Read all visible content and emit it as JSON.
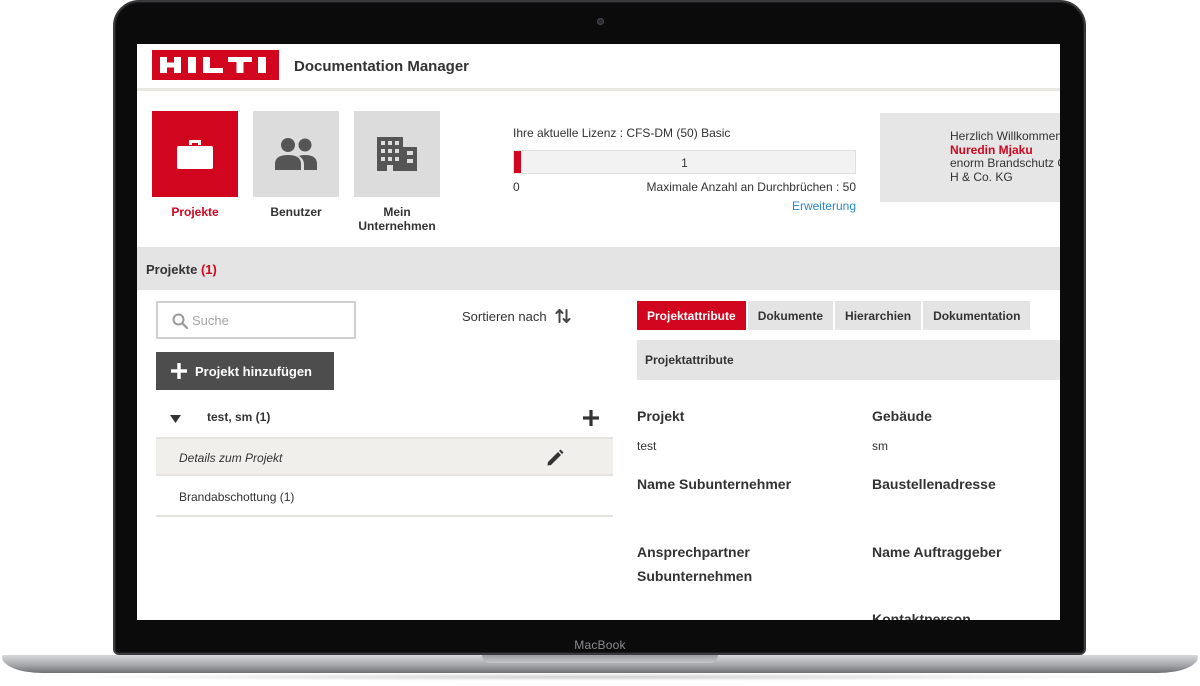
{
  "app": {
    "logo_text": "HILTI",
    "title": "Documentation Manager"
  },
  "nav": {
    "tiles": [
      {
        "label": "Projekte",
        "icon": "briefcase-icon",
        "active": true
      },
      {
        "label": "Benutzer",
        "icon": "users-icon",
        "active": false
      },
      {
        "label": "Mein\nUnternehmen",
        "icon": "building-icon",
        "active": false
      }
    ]
  },
  "license": {
    "text": "Ihre aktuelle Lizenz : CFS-DM (50) Basic",
    "current": "1",
    "used_fraction": 0.02,
    "min": "0",
    "max_text": "Maximale Anzahl an Durchbrüchen : 50",
    "upgrade_link": "Erweiterung"
  },
  "welcome": {
    "greeting": "Herzlich Willkommen",
    "name": "Nuredin Mjaku",
    "company_line1": "enorm Brandschutz G",
    "company_line2": "H & Co. KG"
  },
  "projects_section": {
    "title": "Projekte",
    "count": "(1)"
  },
  "search": {
    "placeholder": "Suche",
    "value": ""
  },
  "sort": {
    "label": "Sortieren nach"
  },
  "add_project": {
    "label": "Projekt hinzufügen"
  },
  "tree": {
    "project": "test, sm (1)",
    "detail": "Details zum Projekt",
    "items": [
      "Brandabschottung (1)"
    ]
  },
  "tabs": [
    "Projektattribute",
    "Dokumente",
    "Hierarchien",
    "Dokumentation"
  ],
  "attributes": {
    "bar_title": "Projektattribute",
    "project_label": "Projekt",
    "project_value": "test",
    "building_label": "Gebäude",
    "building_value": "sm",
    "subcontractor_label": "Name Subunternehmer",
    "site_address_label": "Baustellenadresse",
    "contact_label_1": "Ansprechpartner",
    "contact_label_2": "Subunternehmen",
    "client_label": "Name Auftraggeber",
    "contact_person_label": "Kontaktperson"
  },
  "device": {
    "label": "MacBook"
  },
  "colors": {
    "brand": "#d2051e",
    "link": "#2b89c7",
    "panel": "#e4e4e4",
    "button_dark": "#4d4d4d"
  }
}
